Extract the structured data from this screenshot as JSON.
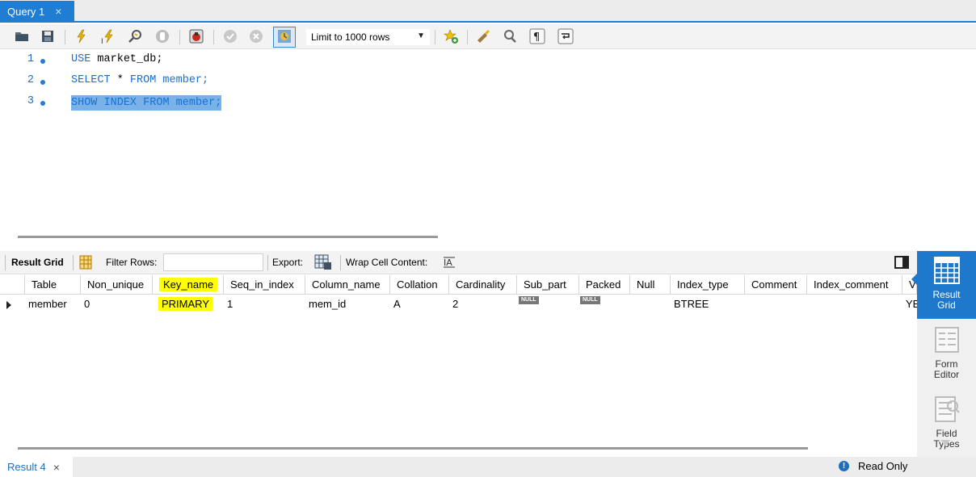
{
  "tabs": {
    "query_tab_label": "Query 1",
    "close_glyph": "×"
  },
  "toolbar": {
    "limit_rows": "Limit to 1000 rows",
    "icons": [
      "open-folder-icon",
      "save-icon",
      "execute-icon",
      "execute-current-icon",
      "explain-icon",
      "stop-icon",
      "toggle-error-icon",
      "commit-icon",
      "rollback-icon",
      "autocommit-icon",
      "bookmark-icon",
      "beautify-icon",
      "find-icon",
      "invisible-chars-icon",
      "wrap-icon"
    ]
  },
  "editor": {
    "lines": [
      {
        "num": "1",
        "kw1": "USE",
        "rest": " market_db;"
      },
      {
        "num": "2",
        "kw1": "SELECT",
        "mid": " * ",
        "kw2": "FROM",
        "rest": " member;"
      },
      {
        "num": "3",
        "kw1": "SHOW",
        "mid1": " ",
        "kw2": "INDEX",
        "mid2": " ",
        "kw3": "FROM",
        "rest": " member;"
      }
    ]
  },
  "result_toolbar": {
    "result_grid": "Result Grid",
    "filter_rows": "Filter Rows:",
    "filter_value": "",
    "export": "Export:",
    "wrap_cell": "Wrap Cell Content:"
  },
  "grid": {
    "columns": [
      "Table",
      "Non_unique",
      "Key_name",
      "Seq_in_index",
      "Column_name",
      "Collation",
      "Cardinality",
      "Sub_part",
      "Packed",
      "Null",
      "Index_type",
      "Comment",
      "Index_comment",
      "Vi"
    ],
    "rows": [
      {
        "Table": "member",
        "Non_unique": "0",
        "Key_name": "PRIMARY",
        "Seq_in_index": "1",
        "Column_name": "mem_id",
        "Collation": "A",
        "Cardinality": "2",
        "Sub_part": "NULL",
        "Packed": "NULL",
        "Null": "",
        "Index_type": "BTREE",
        "Comment": "",
        "Index_comment": "",
        "Vi": "YE"
      }
    ],
    "highlighted_column": "Key_name"
  },
  "side_panel": {
    "result_grid_line1": "Result",
    "result_grid_line2": "Grid",
    "form_editor_line1": "Form",
    "form_editor_line2": "Editor",
    "field_types_line1": "Field",
    "field_types_line2": "Types"
  },
  "bottom": {
    "result_tab": "Result 4",
    "close_glyph": "×",
    "status": "Read Only"
  },
  "colors": {
    "accent": "#1e78cc",
    "highlight": "#ffff00",
    "selection": "#78b2e6"
  }
}
